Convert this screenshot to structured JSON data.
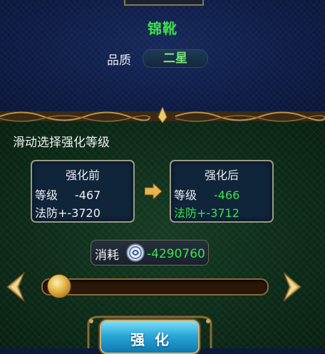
{
  "item": {
    "name": "锦靴",
    "quality_label": "品质",
    "quality_value": "二星"
  },
  "panel": {
    "instruction": "滑动选择强化等级"
  },
  "before": {
    "title": "强化前",
    "level_label": "等级",
    "level_value": "-467",
    "magic_def_label": "法防+",
    "magic_def_value": "-3720"
  },
  "after": {
    "title": "强化后",
    "level_label": "等级",
    "level_value": "-466",
    "magic_def_label": "法防+",
    "magic_def_value": "-3712"
  },
  "cost": {
    "label": "消耗",
    "icon": "silver-coin-icon",
    "value": "-4290760"
  },
  "slider": {
    "level": 0
  },
  "actions": {
    "enhance_label": "强化"
  },
  "colors": {
    "green_text": "#3ee34a",
    "top_bg": "#0d1c46",
    "bottom_bg": "#0c2a18",
    "gold_frame": "#c9b27a",
    "button_blue": "#2aa8d8"
  }
}
